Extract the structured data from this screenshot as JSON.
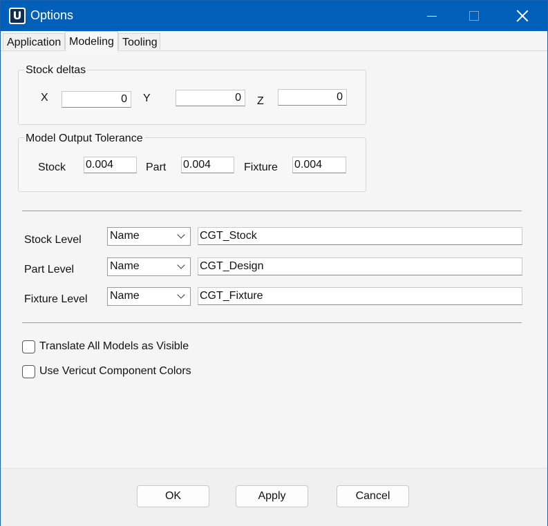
{
  "window": {
    "title": "Options",
    "app_icon_letter": "U"
  },
  "tabs": [
    {
      "label": "Application",
      "selected": false
    },
    {
      "label": "Modeling",
      "selected": true
    },
    {
      "label": "Tooling",
      "selected": false
    }
  ],
  "stock_deltas": {
    "title": "Stock deltas",
    "x_label": "X",
    "x_value": "0",
    "y_label": "Y",
    "y_value": "0",
    "z_label": "Z",
    "z_value": "0"
  },
  "tolerance": {
    "title": "Model Output Tolerance",
    "stock_label": "Stock",
    "stock_value": "0.004",
    "part_label": "Part",
    "part_value": "0.004",
    "fixture_label": "Fixture",
    "fixture_value": "0.004"
  },
  "levels": [
    {
      "label": "Stock Level",
      "select": "Name",
      "value": "CGT_Stock"
    },
    {
      "label": "Part Level",
      "select": "Name",
      "value": "CGT_Design"
    },
    {
      "label": "Fixture Level",
      "select": "Name",
      "value": "CGT_Fixture"
    }
  ],
  "checkboxes": [
    {
      "label": "Translate All Models as Visible",
      "checked": false
    },
    {
      "label": "Use Vericut Component Colors",
      "checked": false
    }
  ],
  "buttons": {
    "ok": "OK",
    "apply": "Apply",
    "cancel": "Cancel"
  },
  "colors": {
    "titlebar": "#005fb8",
    "background": "#f5f5f5"
  }
}
